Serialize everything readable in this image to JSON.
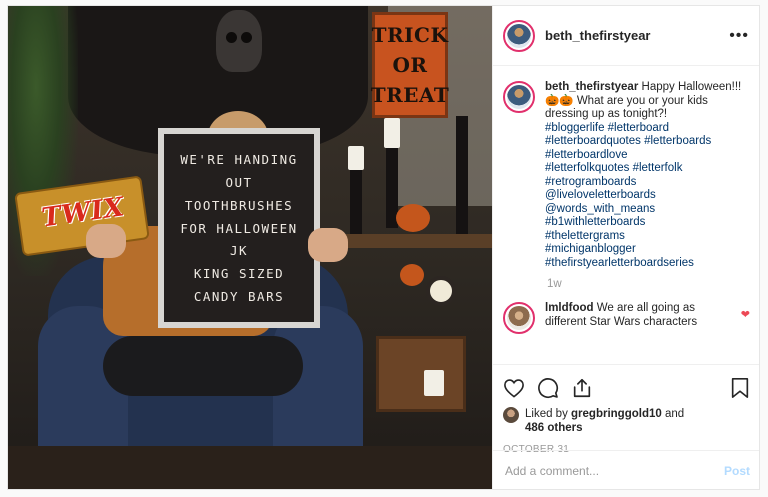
{
  "post": {
    "username": "beth_thefirstyear",
    "caption_text": "Happy Halloween!!! 🎃🎃 What are you or your kids dressing up as tonight?!",
    "hashtags": [
      "#bloggerlife #letterboard",
      "#letterboardquotes #letterboards",
      "#letterboardlove",
      "#letterfolkquotes #letterfolk",
      "#retrogramboards",
      "@liveloveletterboards",
      "@words_with_means",
      "#b1withletterboards",
      "#thelettergrams",
      "#michiganblogger",
      "#thefirstyearletterboardseries"
    ],
    "time_ago": "1w"
  },
  "photo": {
    "tot_sign": [
      "TRICK",
      "OR",
      "TREAT"
    ],
    "board_lines": [
      "WE'RE HANDING",
      "OUT",
      "TOOTHBRUSHES",
      "FOR HALLOWEEN",
      "JK",
      "KING SIZED",
      "CANDY BARS"
    ],
    "candy_logo": "TWIX"
  },
  "comment": {
    "username": "lmldfood",
    "text": "We are all going as different Star Wars characters"
  },
  "likes": {
    "prefix": "Liked by ",
    "user": "gregbringgold10",
    "middle": " and ",
    "others": "486 others"
  },
  "date": "OCTOBER 31",
  "add_comment": {
    "placeholder": "Add a comment...",
    "post_label": "Post"
  },
  "icons": {
    "more": "more-options-icon",
    "like": "heart-icon",
    "comment": "comment-icon",
    "share": "share-icon",
    "save": "bookmark-icon"
  },
  "colors": {
    "hashtag": "#003569",
    "story_ring": "#e1306c",
    "liked_heart": "#ed4956",
    "post_disabled": "#b3dbff"
  }
}
